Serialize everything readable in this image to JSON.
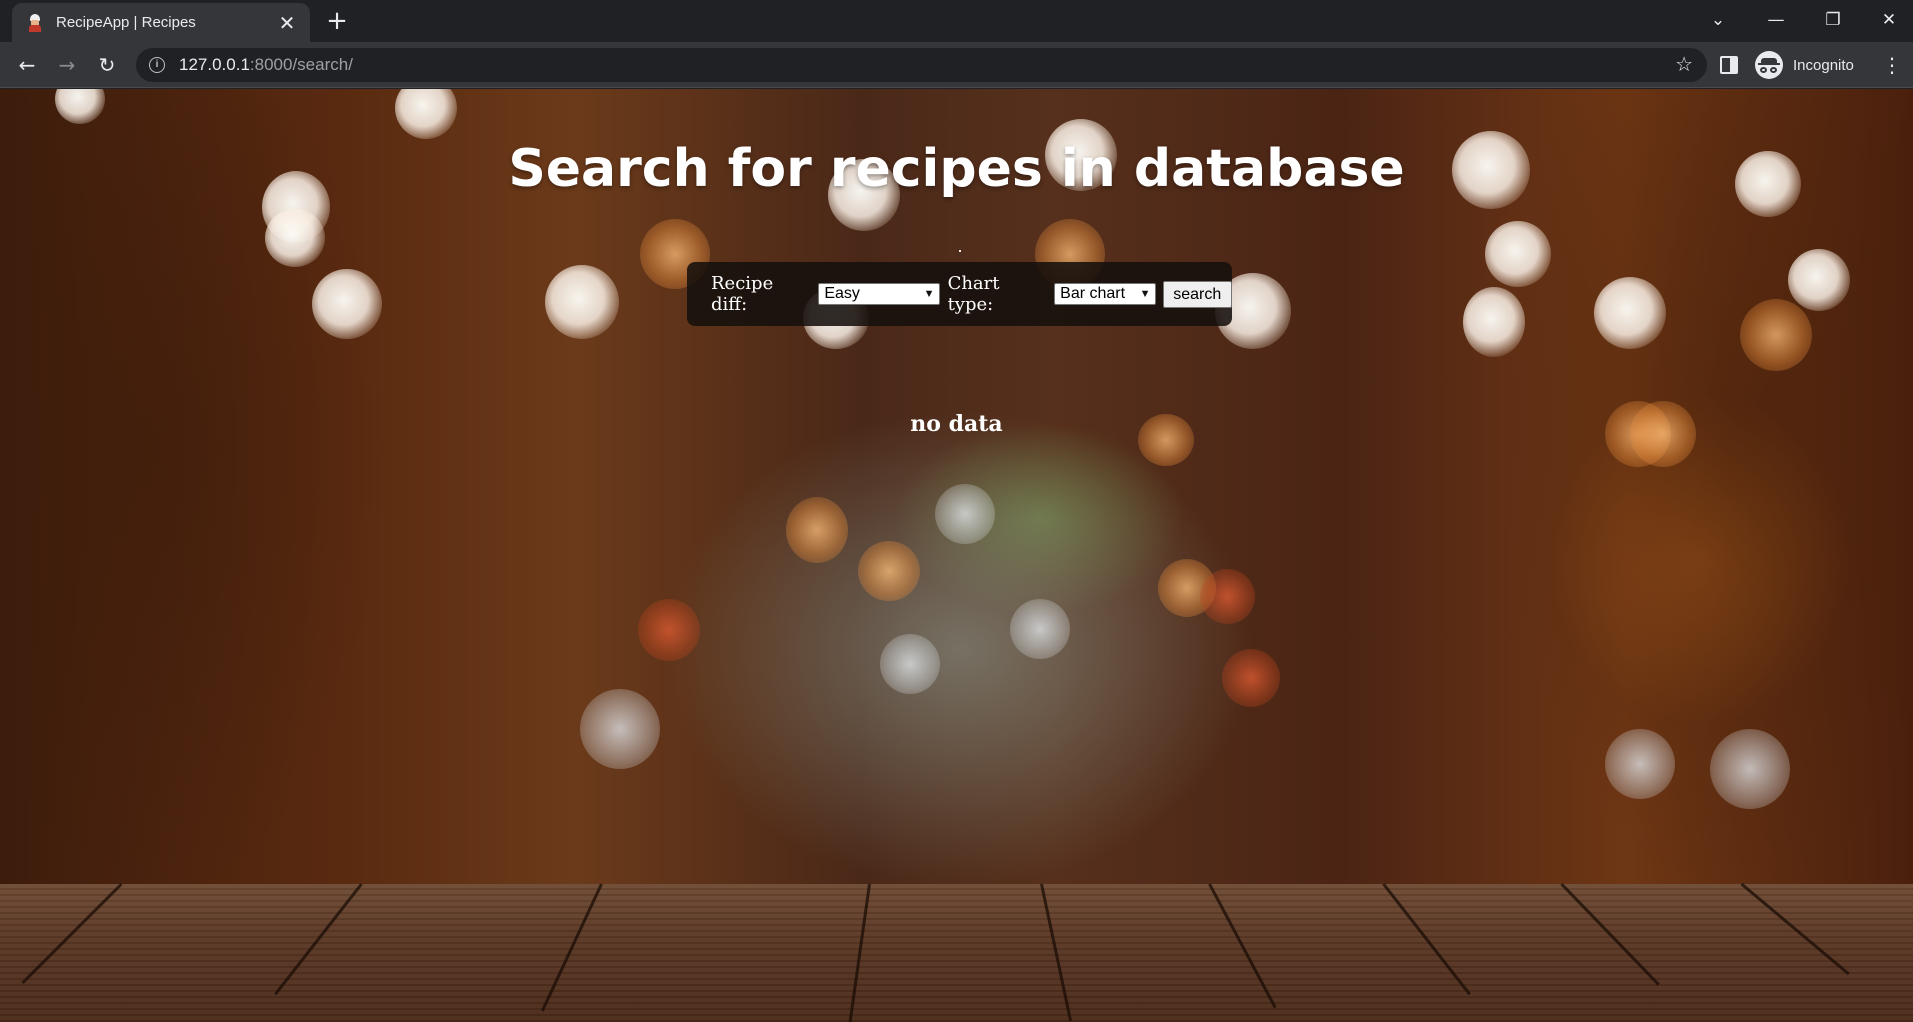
{
  "browser": {
    "tab_title": "RecipeApp | Recipes",
    "tab_close": "✕",
    "new_tab": "+",
    "url_host": "127.0.0.1",
    "url_path": ":8000/search/",
    "profile_label": "Incognito",
    "window_controls": {
      "tab_search": "⌄",
      "minimize": "—",
      "restore": "❐",
      "close": "✕"
    },
    "nav": {
      "back": "←",
      "forward": "→",
      "reload": "↻",
      "bookmark": "☆",
      "menu": "⋮"
    }
  },
  "page": {
    "title": "Search for recipes in database",
    "form": {
      "difficulty_label": "Recipe diff:",
      "difficulty_value": "Easy",
      "chart_type_label": "Chart type:",
      "chart_type_value": "Bar chart",
      "search_button": "search"
    },
    "result_text": "no data"
  },
  "icons": {
    "favicon": "chef-icon",
    "info": "info-icon",
    "star": "star-icon",
    "side_panel": "side-panel-icon",
    "incognito": "incognito-icon"
  }
}
